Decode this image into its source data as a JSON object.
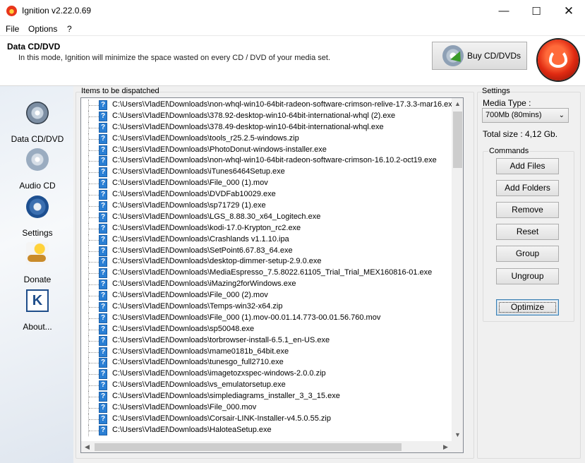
{
  "window": {
    "title": "Ignition v2.22.0.69",
    "minimize": "—",
    "maximize": "☐",
    "close": "✕"
  },
  "menu": [
    "File",
    "Options",
    "?"
  ],
  "header": {
    "title": "Data CD/DVD",
    "description": "In this mode, Ignition will minimize the space wasted on every CD / DVD of your media set.",
    "buy_label": "Buy CD/DVDs"
  },
  "sidebar": {
    "items": [
      {
        "label": "Data CD/DVD",
        "icon": "dvd-disc-icon"
      },
      {
        "label": "Audio CD",
        "icon": "audio-cd-icon"
      },
      {
        "label": "Settings",
        "icon": "gear-icon"
      },
      {
        "label": "Donate",
        "icon": "donate-icon"
      },
      {
        "label": "About...",
        "icon": "about-icon"
      }
    ]
  },
  "items_panel": {
    "label": "Items to be dispatched",
    "files": [
      "C:\\Users\\VladEl\\Downloads\\non-whql-win10-64bit-radeon-software-crimson-relive-17.3.3-mar16.exe",
      "C:\\Users\\VladEl\\Downloads\\378.92-desktop-win10-64bit-international-whql (2).exe",
      "C:\\Users\\VladEl\\Downloads\\378.49-desktop-win10-64bit-international-whql.exe",
      "C:\\Users\\VladEl\\Downloads\\tools_r25.2.5-windows.zip",
      "C:\\Users\\VladEl\\Downloads\\PhotoDonut-windows-installer.exe",
      "C:\\Users\\VladEl\\Downloads\\non-whql-win10-64bit-radeon-software-crimson-16.10.2-oct19.exe",
      "C:\\Users\\VladEl\\Downloads\\iTunes6464Setup.exe",
      "C:\\Users\\VladEl\\Downloads\\File_000 (1).mov",
      "C:\\Users\\VladEl\\Downloads\\DVDFab10029.exe",
      "C:\\Users\\VladEl\\Downloads\\sp71729 (1).exe",
      "C:\\Users\\VladEl\\Downloads\\LGS_8.88.30_x64_Logitech.exe",
      "C:\\Users\\VladEl\\Downloads\\kodi-17.0-Krypton_rc2.exe",
      "C:\\Users\\VladEl\\Downloads\\Crashlands v1.1.10.ipa",
      "C:\\Users\\VladEl\\Downloads\\SetPoint6.67.83_64.exe",
      "C:\\Users\\VladEl\\Downloads\\desktop-dimmer-setup-2.9.0.exe",
      "C:\\Users\\VladEl\\Downloads\\MediaEspresso_7.5.8022.61105_Trial_Trial_MEX160816-01.exe",
      "C:\\Users\\VladEl\\Downloads\\iMazing2forWindows.exe",
      "C:\\Users\\VladEl\\Downloads\\File_000 (2).mov",
      "C:\\Users\\VladEl\\Downloads\\Temps-win32-x64.zip",
      "C:\\Users\\VladEl\\Downloads\\File_000 (1).mov-00.01.14.773-00.01.56.760.mov",
      "C:\\Users\\VladEl\\Downloads\\sp50048.exe",
      "C:\\Users\\VladEl\\Downloads\\torbrowser-install-6.5.1_en-US.exe",
      "C:\\Users\\VladEl\\Downloads\\mame0181b_64bit.exe",
      "C:\\Users\\VladEl\\Downloads\\tunesgo_full2710.exe",
      "C:\\Users\\VladEl\\Downloads\\imagetozxspec-windows-2.0.0.zip",
      "C:\\Users\\VladEl\\Downloads\\vs_emulatorsetup.exe",
      "C:\\Users\\VladEl\\Downloads\\simplediagrams_installer_3_3_15.exe",
      "C:\\Users\\VladEl\\Downloads\\File_000.mov",
      "C:\\Users\\VladEl\\Downloads\\Corsair-LINK-Installer-v4.5.0.55.zip",
      "C:\\Users\\VladEl\\Downloads\\HaloteaSetup.exe"
    ]
  },
  "settings": {
    "label": "Settings",
    "media_type_label": "Media Type :",
    "media_type_value": "700Mb (80mins)",
    "total_size": "Total size : 4,12 Gb.",
    "commands_label": "Commands",
    "buttons": [
      "Add Files",
      "Add Folders",
      "Remove",
      "Reset",
      "Group",
      "Ungroup",
      "Optimize"
    ]
  }
}
